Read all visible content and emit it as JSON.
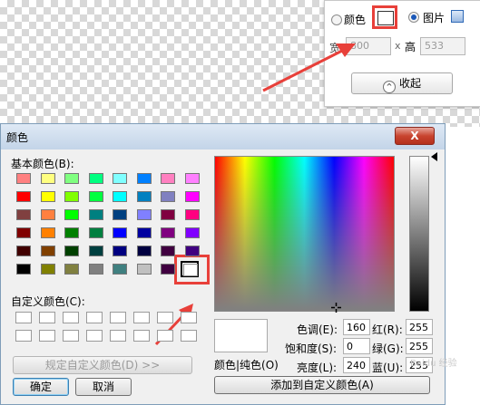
{
  "panel": {
    "color_label": "颜色",
    "image_label": "图片",
    "width_label": "宽",
    "width_value": "800",
    "x_label": "x",
    "height_label": "高",
    "height_value": "533",
    "collapse_label": "收起",
    "collapse_icon": "^"
  },
  "dialog": {
    "title": "颜色",
    "close_label": "X",
    "basic_colors_label": "基本颜色(B):",
    "basic_colors": [
      [
        "#ff8080",
        "#ffff80",
        "#80ff80",
        "#00ff80",
        "#80ffff",
        "#0080ff",
        "#ff80c0",
        "#ff80ff"
      ],
      [
        "#ff0000",
        "#ffff00",
        "#80ff00",
        "#00ff40",
        "#00ffff",
        "#0080c0",
        "#8080c0",
        "#ff00ff"
      ],
      [
        "#804040",
        "#ff8040",
        "#00ff00",
        "#008080",
        "#004080",
        "#8080ff",
        "#800040",
        "#ff0080"
      ],
      [
        "#800000",
        "#ff8000",
        "#008000",
        "#008040",
        "#0000ff",
        "#0000a0",
        "#800080",
        "#8000ff"
      ],
      [
        "#400000",
        "#804000",
        "#004000",
        "#004040",
        "#000080",
        "#000040",
        "#400040",
        "#400080"
      ],
      [
        "#000000",
        "#808000",
        "#808040",
        "#808080",
        "#408080",
        "#c0c0c0",
        "#400040"
      ]
    ],
    "selected_basic_color": "#ffffff",
    "custom_colors_label": "自定义颜色(C):",
    "define_custom_label": "规定自定义颜色(D) >>",
    "ok_label": "确定",
    "cancel_label": "取消",
    "preview_label": "颜色|纯色(O)",
    "hue_label": "色调(E):",
    "hue_value": "160",
    "sat_label": "饱和度(S):",
    "sat_value": "0",
    "lum_label": "亮度(L):",
    "lum_value": "240",
    "red_label": "红(R):",
    "red_value": "255",
    "green_label": "绿(G):",
    "green_value": "255",
    "blue_label": "蓝(U):",
    "blue_value": "255",
    "add_custom_label": "添加到自定义颜色(A)"
  },
  "accent_colors": {
    "highlight": "#e8403a",
    "titlebar": "#c3d4e8"
  },
  "watermark": "Baidu 经验"
}
